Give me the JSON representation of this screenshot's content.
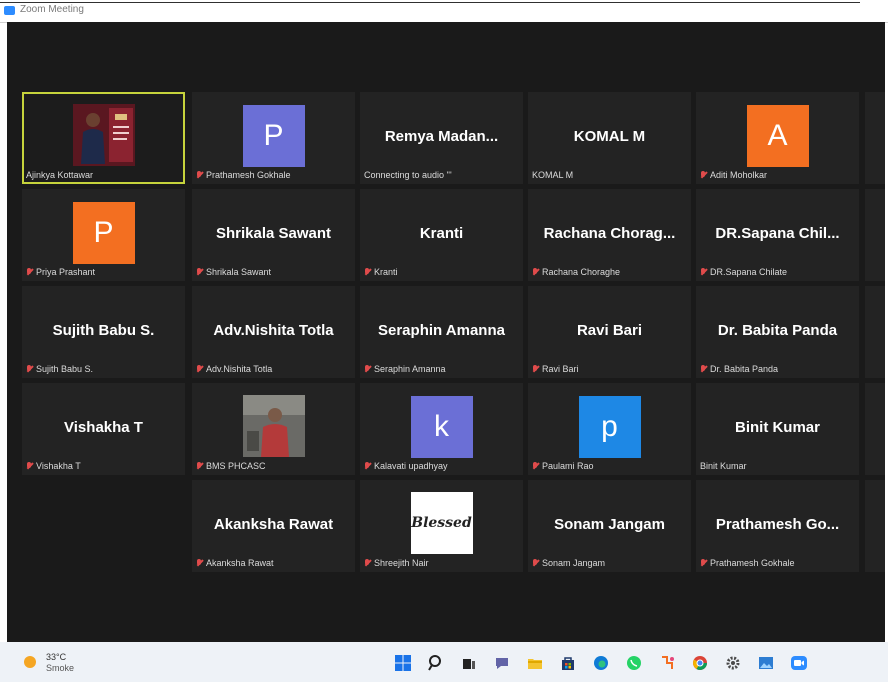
{
  "window": {
    "title": "Zoom Meeting"
  },
  "tiles": [
    {
      "big": "",
      "label": "Ajinkya Kottawar",
      "muted": false,
      "active": true
    },
    {
      "big": "",
      "label": "Prathamesh Gokhale",
      "muted": true,
      "avatar_letter": "P"
    },
    {
      "big": "Remya  Madan...",
      "label": "Connecting to audio '''",
      "muted": false
    },
    {
      "big": "KOMAL M",
      "label": "KOMAL M",
      "muted": false
    },
    {
      "big": "",
      "label": "Aditi Moholkar",
      "muted": true,
      "avatar_letter": "A"
    },
    {
      "big": "",
      "label": "Priya Prashant",
      "muted": true,
      "avatar_letter": "P"
    },
    {
      "big": "Shrikala Sawant",
      "label": "Shrikala Sawant",
      "muted": true
    },
    {
      "big": "Kranti",
      "label": "Kranti",
      "muted": true
    },
    {
      "big": "Rachana  Chorag...",
      "label": "Rachana Choraghe",
      "muted": true
    },
    {
      "big": "DR.Sapana  Chil...",
      "label": "DR.Sapana Chilate",
      "muted": true
    },
    {
      "big": "Sujith Babu S.",
      "label": "Sujith Babu S.",
      "muted": true
    },
    {
      "big": "Adv.Nishita Totla",
      "label": "Adv.Nishita Totla",
      "muted": true
    },
    {
      "big": "Seraphin Amanna",
      "label": "Seraphin Amanna",
      "muted": true
    },
    {
      "big": "Ravi Bari",
      "label": "Ravi Bari",
      "muted": true
    },
    {
      "big": "Dr. Babita Panda",
      "label": "Dr. Babita Panda",
      "muted": true
    },
    {
      "big": "Vishakha T",
      "label": "Vishakha T",
      "muted": true
    },
    {
      "big": "",
      "label": "BMS PHCASC",
      "muted": true
    },
    {
      "big": "",
      "label": "Kalavati upadhyay",
      "muted": true,
      "avatar_letter": "k"
    },
    {
      "big": "",
      "label": "Paulami Rao",
      "muted": true,
      "avatar_letter": "p"
    },
    {
      "big": "Binit Kumar",
      "label": "Binit Kumar",
      "muted": false
    },
    {
      "big": "Akanksha Rawat",
      "label": "Akanksha Rawat",
      "muted": true
    },
    {
      "big": "",
      "label": "Shreejith Nair",
      "muted": true,
      "blessed_text": "Blessed"
    },
    {
      "big": "Sonam Jangam",
      "label": "Sonam Jangam",
      "muted": true
    },
    {
      "big": "Prathamesh  Go...",
      "label": "Prathamesh Gokhale",
      "muted": true
    }
  ],
  "taskbar": {
    "weather": {
      "temp": "33°C",
      "desc": "Smoke"
    },
    "icons": [
      "windows-start-icon",
      "search-icon",
      "task-view-icon",
      "chat-icon",
      "file-explorer-icon",
      "store-icon",
      "edge-icon",
      "whatsapp-icon",
      "paint-icon",
      "chrome-icon",
      "settings-icon",
      "photos-icon",
      "zoom-icon"
    ]
  },
  "colors": {
    "active_border": "#c6d33c",
    "avatar_purple": "#6b6fd6",
    "avatar_orange": "#f36f21",
    "avatar_blue": "#1e88e5",
    "tile_bg": "#232323",
    "meeting_bg": "#1a1a1a"
  }
}
